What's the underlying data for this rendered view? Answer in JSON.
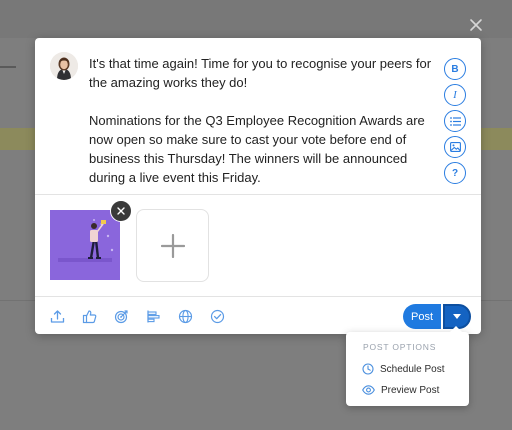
{
  "message": {
    "paragraph_1": "It's that time again! Time for you to recognise your peers for the amazing works they do!",
    "paragraph_2": "Nominations for the Q3 Employee Recognition Awards are now open so make sure to cast your vote before end of business this Thursday! The winners will be announced during a live event this Friday."
  },
  "formatting_toolbar": [
    {
      "name": "bold",
      "label": "B",
      "icon": "bold-icon"
    },
    {
      "name": "italic",
      "label": "I",
      "icon": "italic-icon"
    },
    {
      "name": "list",
      "icon": "list-icon"
    },
    {
      "name": "image",
      "icon": "image-icon"
    },
    {
      "name": "help",
      "label": "?",
      "icon": "help-icon"
    }
  ],
  "action_bar": [
    {
      "name": "upload",
      "icon": "upload-icon"
    },
    {
      "name": "praise",
      "icon": "thumbs-up-icon"
    },
    {
      "name": "goal",
      "icon": "target-icon"
    },
    {
      "name": "poll",
      "icon": "bar-chart-icon"
    },
    {
      "name": "globe",
      "icon": "globe-icon"
    },
    {
      "name": "task",
      "icon": "check-circle-icon"
    }
  ],
  "post_button": {
    "label": "Post"
  },
  "post_menu": {
    "heading": "POST OPTIONS",
    "items": [
      {
        "label": "Schedule Post",
        "icon": "clock-icon"
      },
      {
        "label": "Preview Post",
        "icon": "eye-icon"
      }
    ]
  },
  "colors": {
    "accent": "#1f7ae0",
    "overlay": "#7e7e7e",
    "attachment_bg": "#8a66dc"
  }
}
